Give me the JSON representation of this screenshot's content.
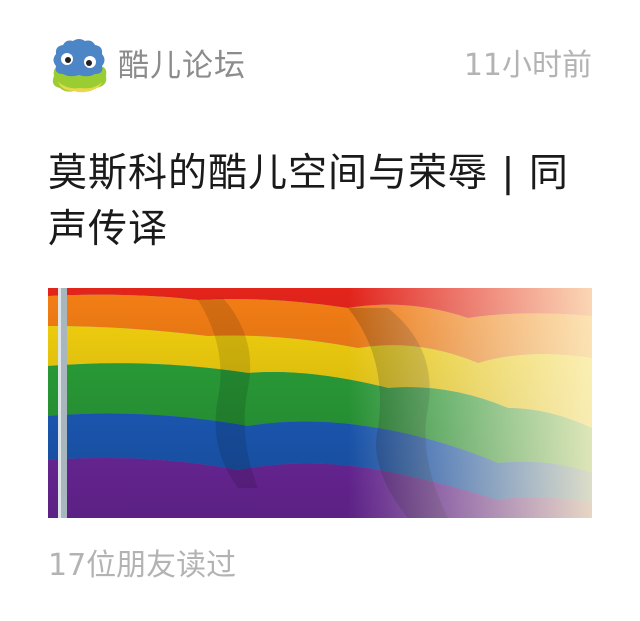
{
  "feed_card": {
    "account": {
      "name": "酷儿论坛",
      "avatar_icon": "blob-monster-avatar-icon"
    },
    "published": "11小时前",
    "title": "莫斯科的酷儿空间与荣辱 | 同声传译",
    "cover_image": {
      "subject": "rainbow-flag-image",
      "colors": [
        "#e8241c",
        "#f57d14",
        "#f5d20f",
        "#2ea83a",
        "#1f63c9",
        "#7b2bb0"
      ]
    },
    "read_count": "17位朋友读过"
  }
}
